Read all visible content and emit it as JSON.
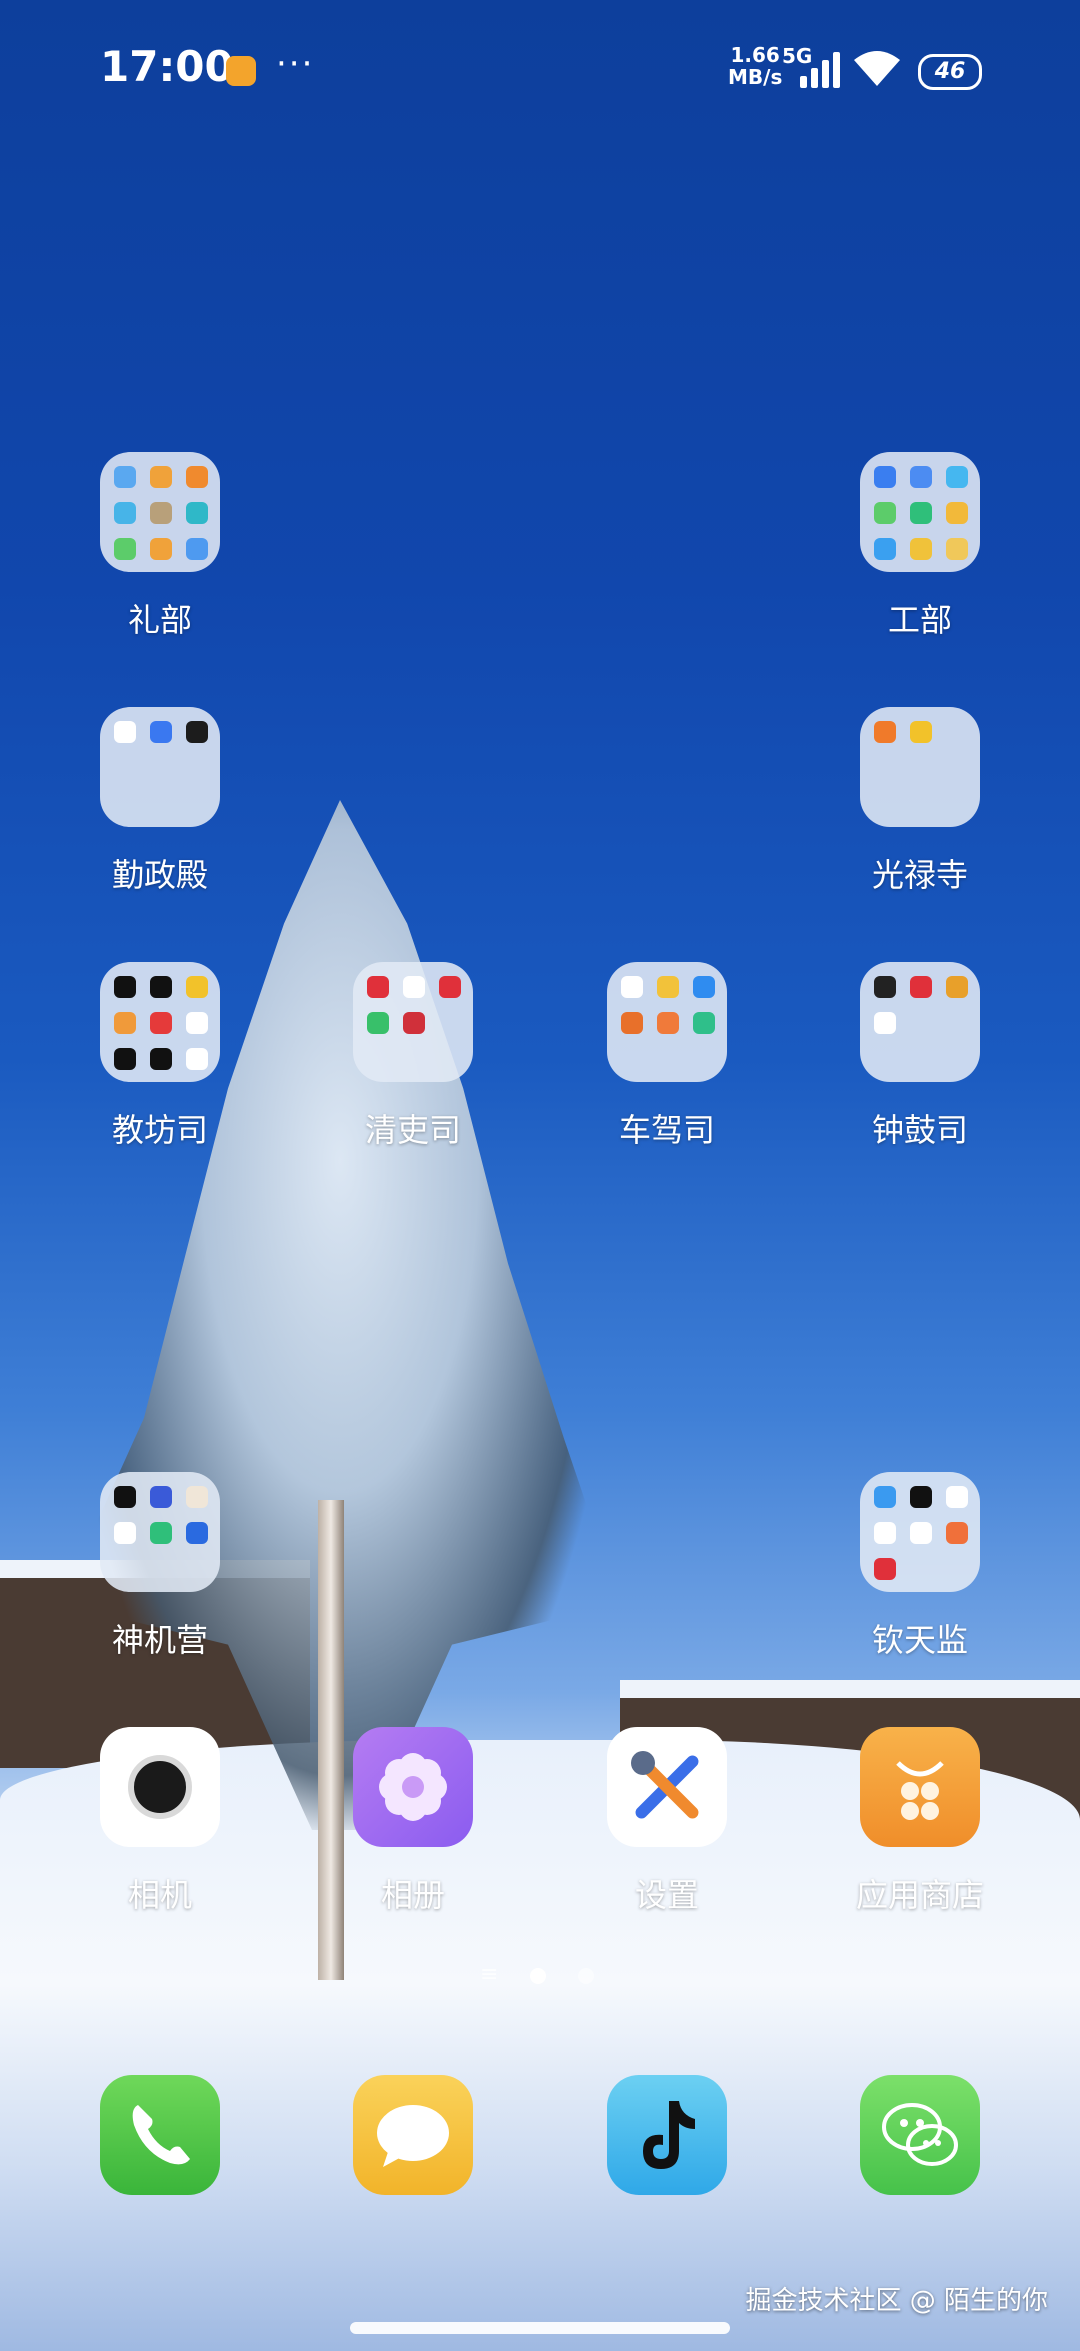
{
  "status_bar": {
    "time": "17:00",
    "more": "···",
    "speed_value": "1.66",
    "speed_unit": "MB/s",
    "network": "5G",
    "battery": "46"
  },
  "folders": [
    {
      "label": "礼部",
      "minis": [
        "#5aa8f0",
        "#f0a23a",
        "#f08a2e",
        "#47b4e8",
        "#b8a07a",
        "#2fb8c8",
        "#5ccc6a",
        "#f0a23a",
        "#4e9af0"
      ]
    },
    {
      "label": "工部",
      "minis": [
        "#3a7ef0",
        "#4c8cf2",
        "#45b7f0",
        "#5ccc6a",
        "#2fbf7a",
        "#f2b93a",
        "#3aa0f0",
        "#f0c23a",
        "#f0c85a"
      ]
    },
    {
      "label": "勤政殿",
      "minis": [
        "#ffffff",
        "#3a78f0",
        "#1c1c1c"
      ]
    },
    {
      "label": "光禄寺",
      "minis": [
        "#f07a2a",
        "#f2c22a"
      ]
    },
    {
      "label": "教坊司",
      "minis": [
        "#111111",
        "#111111",
        "#f2c22a",
        "#f09a3a",
        "#e53a3a",
        "#ffffff",
        "#111111",
        "#111111",
        "#ffffff"
      ]
    },
    {
      "label": "清吏司",
      "minis": [
        "#e0303a",
        "#ffffff",
        "#e0303a",
        "#38c06a",
        "#d0303a"
      ]
    },
    {
      "label": "车驾司",
      "minis": [
        "#ffffff",
        "#f2c23a",
        "#2f8cf0",
        "#e8702a",
        "#f07a3a",
        "#2fbf8a"
      ]
    },
    {
      "label": "钟鼓司",
      "minis": [
        "#222222",
        "#e0303a",
        "#e8a02a",
        "#ffffff"
      ]
    },
    {
      "label": "神机营",
      "minis": [
        "#111111",
        "#3a5ad8",
        "#f0e6d8",
        "#ffffff",
        "#2fbf7a",
        "#2a6ae0"
      ]
    },
    {
      "label": "钦天监",
      "minis": [
        "#3a9af0",
        "#111111",
        "#ffffff",
        "#ffffff",
        "#ffffff",
        "#f0703a",
        "#e0303a"
      ]
    }
  ],
  "apps": {
    "camera": "相机",
    "gallery": "相册",
    "settings": "设置",
    "store": "应用商店"
  },
  "dock": {
    "phone": "phone",
    "messages": "messages",
    "tiktok": "tiktok",
    "wechat": "wechat"
  },
  "watermark": "掘金技术社区 @ 陌生的你"
}
